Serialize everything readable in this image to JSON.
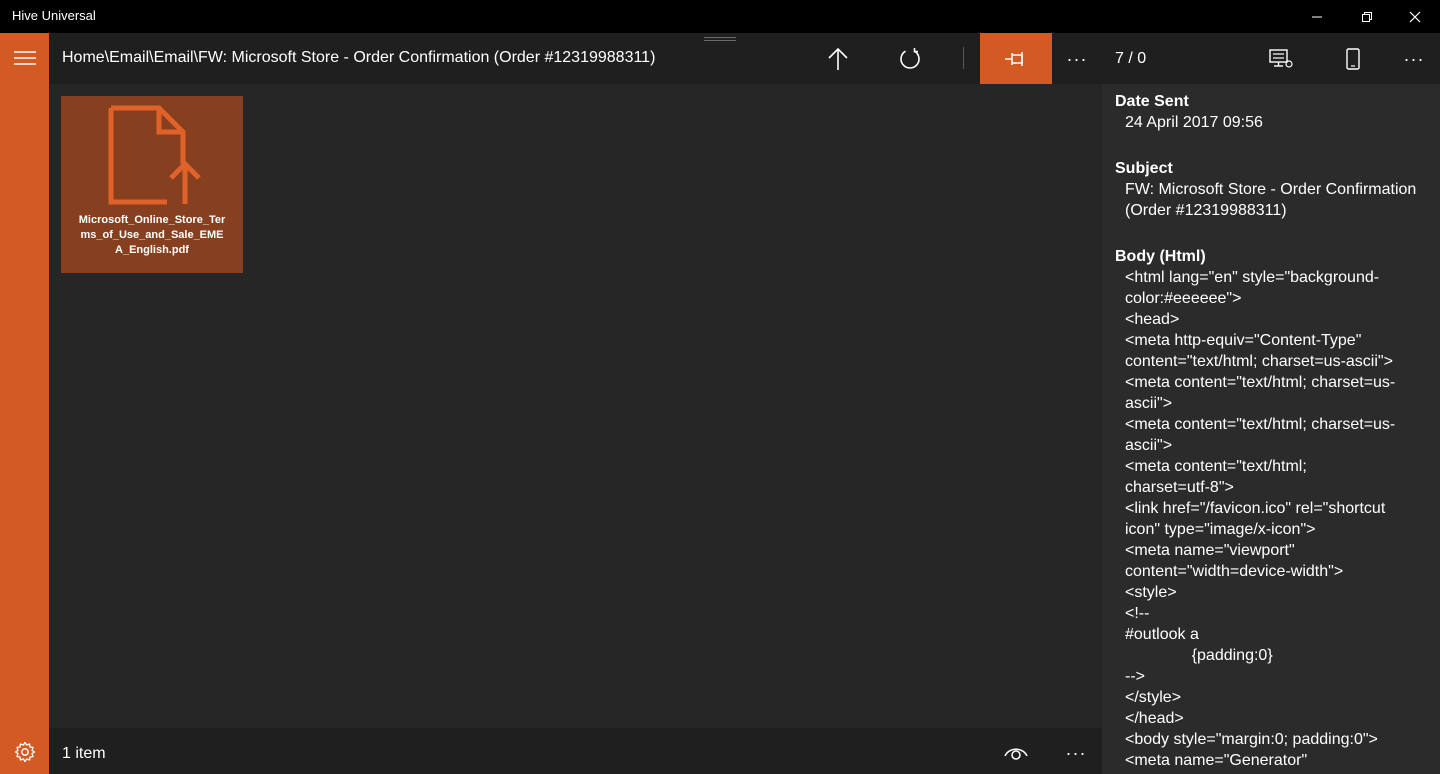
{
  "window": {
    "title": "Hive Universal",
    "controls": [
      "minimize-icon",
      "restore-icon",
      "close-icon"
    ]
  },
  "rail": {
    "menu_icon": "hamburger-icon",
    "settings_icon": "gear-icon",
    "accent": "#d45a23"
  },
  "toolbar": {
    "breadcrumb": "Home\\Email\\Email\\FW: Microsoft Store - Order Confirmation (Order #12319988311)",
    "up_icon": "arrow-up-icon",
    "refresh_icon": "refresh-icon",
    "pin_icon": "pin-icon",
    "more_label": "···"
  },
  "content": {
    "items": [
      {
        "name": "Microsoft_Online_Store_Terms_of_Use_and_Sale_EMEA_English.pdf",
        "icon": "file-upload-icon"
      }
    ]
  },
  "status": {
    "count": "1 item",
    "eye_icon": "eye-icon",
    "more_label": "···"
  },
  "details": {
    "counter": "7 / 0",
    "more_label": "···",
    "date_sent_label": "Date Sent",
    "date_sent": "24 April 2017 09:56",
    "subject_label": "Subject",
    "subject": "FW: Microsoft Store - Order Confirmation (Order #12319988311)",
    "body_label": "Body (Html)",
    "body_lines": [
      "<html lang=\"en\" style=\"background-",
      "color:#eeeeee\">",
      "<head>",
      "<meta http-equiv=\"Content-Type\"",
      "content=\"text/html; charset=us-ascii\">",
      "<meta content=\"text/html; charset=us-",
      "ascii\">",
      "<meta content=\"text/html; charset=us-",
      "ascii\">",
      "<meta content=\"text/html;",
      "charset=utf-8\">",
      "<link href=\"/favicon.ico\" rel=\"shortcut",
      "icon\" type=\"image/x-icon\">",
      "<meta name=\"viewport\"",
      "content=\"width=device-width\">",
      "<style>",
      "<!--",
      "#outlook a",
      "               {padding:0}",
      "-->",
      "</style>",
      "</head>",
      "<body style=\"margin:0; padding:0\">",
      "<meta name=\"Generator\""
    ]
  }
}
